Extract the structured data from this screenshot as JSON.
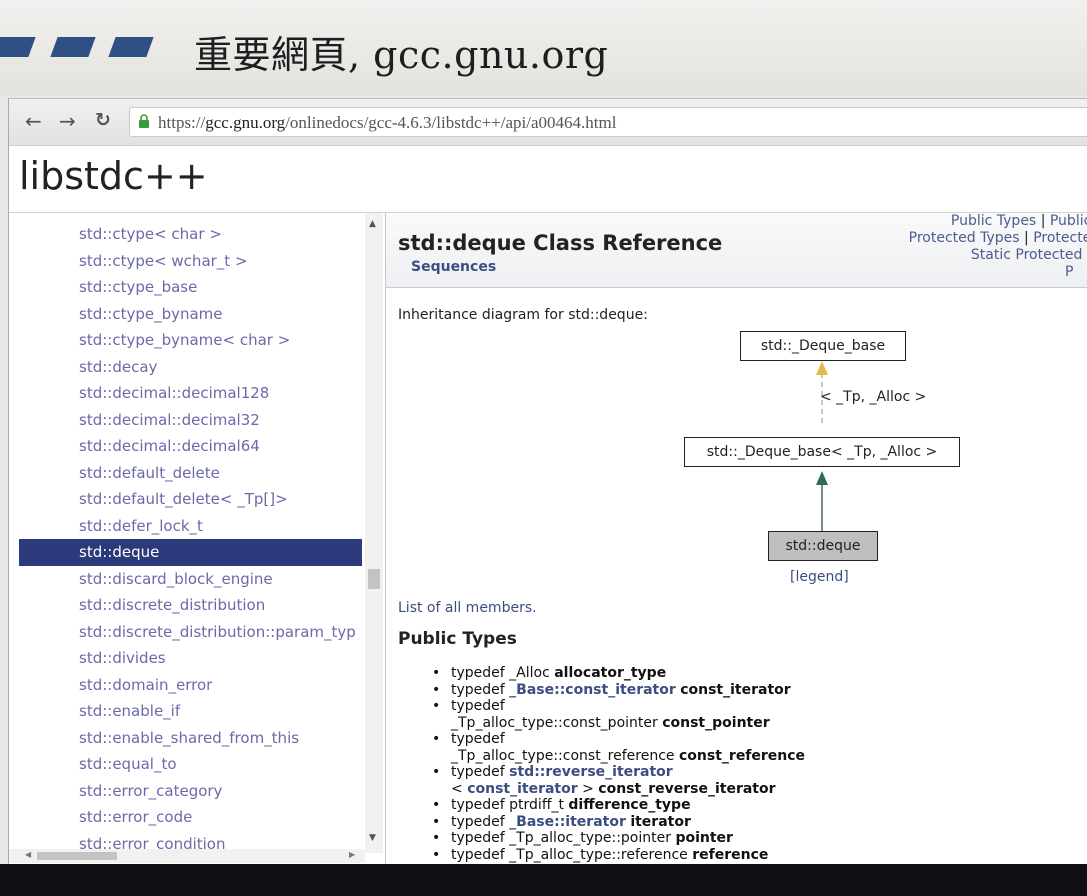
{
  "slide": {
    "title": "重要網頁, gcc.gnu.org"
  },
  "browser": {
    "url_scheme": "https://",
    "url_host": "gcc.gnu.org",
    "url_path": "/onlinedocs/gcc-4.6.3/libstdc++/api/a00464.html",
    "back_icon": "back-arrow-icon",
    "forward_icon": "forward-arrow-icon",
    "reload_icon": "reload-icon",
    "lock_icon": "lock-icon",
    "lock_color": "#3c9b3c"
  },
  "site": {
    "title": "libstdc++"
  },
  "sidebar": {
    "items": [
      {
        "label": "std::ctype< char >",
        "active": false
      },
      {
        "label": "std::ctype< wchar_t >",
        "active": false
      },
      {
        "label": "std::ctype_base",
        "active": false
      },
      {
        "label": "std::ctype_byname",
        "active": false
      },
      {
        "label": "std::ctype_byname< char >",
        "active": false
      },
      {
        "label": "std::decay",
        "active": false
      },
      {
        "label": "std::decimal::decimal128",
        "active": false
      },
      {
        "label": "std::decimal::decimal32",
        "active": false
      },
      {
        "label": "std::decimal::decimal64",
        "active": false
      },
      {
        "label": "std::default_delete",
        "active": false
      },
      {
        "label": "std::default_delete< _Tp[]>",
        "active": false
      },
      {
        "label": "std::defer_lock_t",
        "active": false
      },
      {
        "label": "std::deque",
        "active": true
      },
      {
        "label": "std::discard_block_engine",
        "active": false
      },
      {
        "label": "std::discrete_distribution",
        "active": false
      },
      {
        "label": "std::discrete_distribution::param_typ",
        "active": false
      },
      {
        "label": "std::divides",
        "active": false
      },
      {
        "label": "std::domain_error",
        "active": false
      },
      {
        "label": "std::enable_if",
        "active": false
      },
      {
        "label": "std::enable_shared_from_this",
        "active": false
      },
      {
        "label": "std::equal_to",
        "active": false
      },
      {
        "label": "std::error_category",
        "active": false
      },
      {
        "label": "std::error_code",
        "active": false
      },
      {
        "label": "std::error_condition",
        "active": false
      }
    ],
    "active_color": "#2b3a7a"
  },
  "content": {
    "class_title": "std::deque Class Reference",
    "group": "Sequences",
    "summary_line1": [
      "Public Types",
      "Public"
    ],
    "summary_line2": [
      "Protected Types",
      "Protected"
    ],
    "summary_line3": "Static Protected",
    "summary_line4": "P",
    "summary_separator": "|",
    "inheritance_intro": "Inheritance diagram for std::deque:",
    "diagram": {
      "base": "std::_Deque_base",
      "template_label": "< _Tp, _Alloc >",
      "instantiated": "std::_Deque_base< _Tp, _Alloc >",
      "current": "std::deque",
      "legend": "[legend]",
      "template_arrow_color": "#e6b84a",
      "inherit_arrow_color": "#2e6b58"
    },
    "members_link": "List of all members.",
    "public_types_heading": "Public Types",
    "public_types": [
      {
        "l1a": "typedef _Alloc ",
        "l1ref": "",
        "l1b": "",
        "name": "allocator_type",
        "l2": ""
      },
      {
        "l1a": "typedef ",
        "l1ref": "_Base::const_iterator",
        "l1b": " ",
        "name": "const_iterator",
        "l2": ""
      },
      {
        "l1a": "typedef",
        "l1ref": "",
        "l1b": "",
        "l2": "_Tp_alloc_type::const_pointer ",
        "name2": "const_pointer"
      },
      {
        "l1a": "typedef",
        "l1ref": "",
        "l1b": "",
        "l2": "_Tp_alloc_type::const_reference ",
        "name2": "const_reference"
      },
      {
        "l1a": "typedef ",
        "l1ref": "std::reverse_iterator",
        "l1b": "",
        "l2": "< ",
        "l2ref": "const_iterator",
        "l2b": " > ",
        "name2": "const_reverse_iterator"
      },
      {
        "l1a": "typedef ptrdiff_t ",
        "l1ref": "",
        "l1b": "",
        "name": "difference_type",
        "l2": ""
      },
      {
        "l1a": "typedef ",
        "l1ref": "_Base::iterator",
        "l1b": " ",
        "name": "iterator",
        "l2": ""
      },
      {
        "l1a": "typedef _Tp_alloc_type::pointer ",
        "l1ref": "",
        "l1b": "",
        "name": "pointer",
        "l2": ""
      },
      {
        "l1a": "typedef _Tp_alloc_type::reference ",
        "l1ref": "",
        "l1b": "",
        "name": "reference",
        "l2": ""
      }
    ]
  }
}
